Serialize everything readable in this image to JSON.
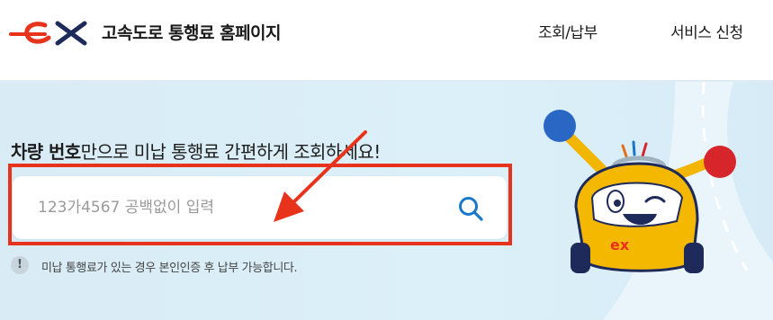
{
  "header": {
    "logo_text": "ex",
    "site_title": "고속도로 통행료 홈페이지",
    "nav": {
      "lookup_pay": "조회/납부",
      "service_apply": "서비스 신청"
    }
  },
  "main": {
    "headline_bold": "차량 번호",
    "headline_rest": "만으로 미납 통행료 간편하게 조회하세요!",
    "search": {
      "placeholder": "123가4567 공백없이 입력",
      "value": "",
      "button_icon": "search-icon"
    },
    "notice": {
      "icon_glyph": "!",
      "text": "미납 통행료가 있는 경우 본인인증 후 납부 가능합니다."
    },
    "mascot_logo_text": "ex"
  },
  "colors": {
    "brand_red": "#e8331c",
    "brand_navy": "#1e2a5a",
    "search_icon_blue": "#1a78c8",
    "background": "#dbeef7"
  }
}
